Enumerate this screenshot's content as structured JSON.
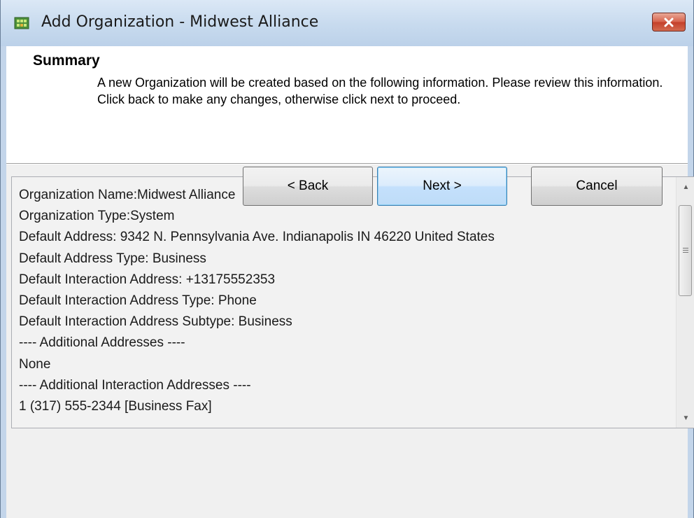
{
  "window": {
    "title": "Add Organization - Midwest Alliance",
    "icon": "app-icon",
    "close_icon": "close-icon",
    "accent_color": "#c4402a"
  },
  "header": {
    "heading": "Summary",
    "description": "A new Organization will be created based on the following information.  Please review this information.  Click back to make any changes, otherwise click next to proceed."
  },
  "summary": {
    "lines": [
      "Organization Name:Midwest Alliance",
      "Organization Type:System",
      "Default Address:  9342 N. Pennsylvania Ave. Indianapolis IN 46220 United States",
      "Default Address Type:  Business",
      "Default Interaction Address:  +13175552353",
      "Default Interaction Address Type:  Phone",
      "Default Interaction Address Subtype:  Business",
      "---- Additional Addresses ----",
      "None",
      "---- Additional Interaction Addresses ----",
      "1 (317) 555-2344  [Business Fax]"
    ]
  },
  "buttons": {
    "back": "< Back",
    "next": "Next >",
    "cancel": "Cancel"
  }
}
